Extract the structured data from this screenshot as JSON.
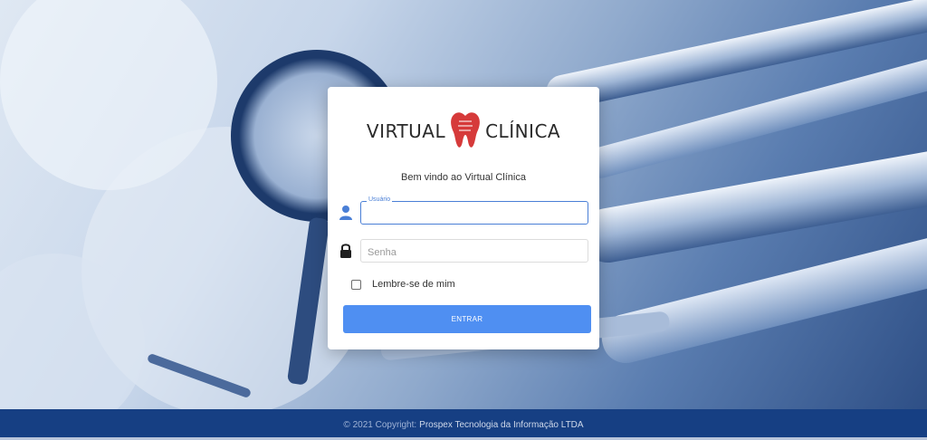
{
  "logo": {
    "word_left": "VIRTUAL",
    "word_right": "CLÍNICA",
    "brand_color": "#d63a3a",
    "icon": "tooth-icon"
  },
  "welcome_text": "Bem vindo ao Virtual Clínica",
  "form": {
    "username": {
      "label": "Usuário",
      "value": "",
      "icon": "user-icon",
      "focused": true
    },
    "password": {
      "placeholder": "Senha",
      "value": "",
      "icon": "lock-icon"
    },
    "remember_label": "Lembre-se de mim",
    "remember_checked": false,
    "submit_label": "ENTRAR"
  },
  "footer": {
    "copyright": "© 2021 Copyright:",
    "company": "Prospex Tecnologia da Informação LTDA"
  },
  "colors": {
    "accent": "#4f8ff2",
    "footer_bg": "#163f83",
    "focus": "#4a7fd6"
  }
}
